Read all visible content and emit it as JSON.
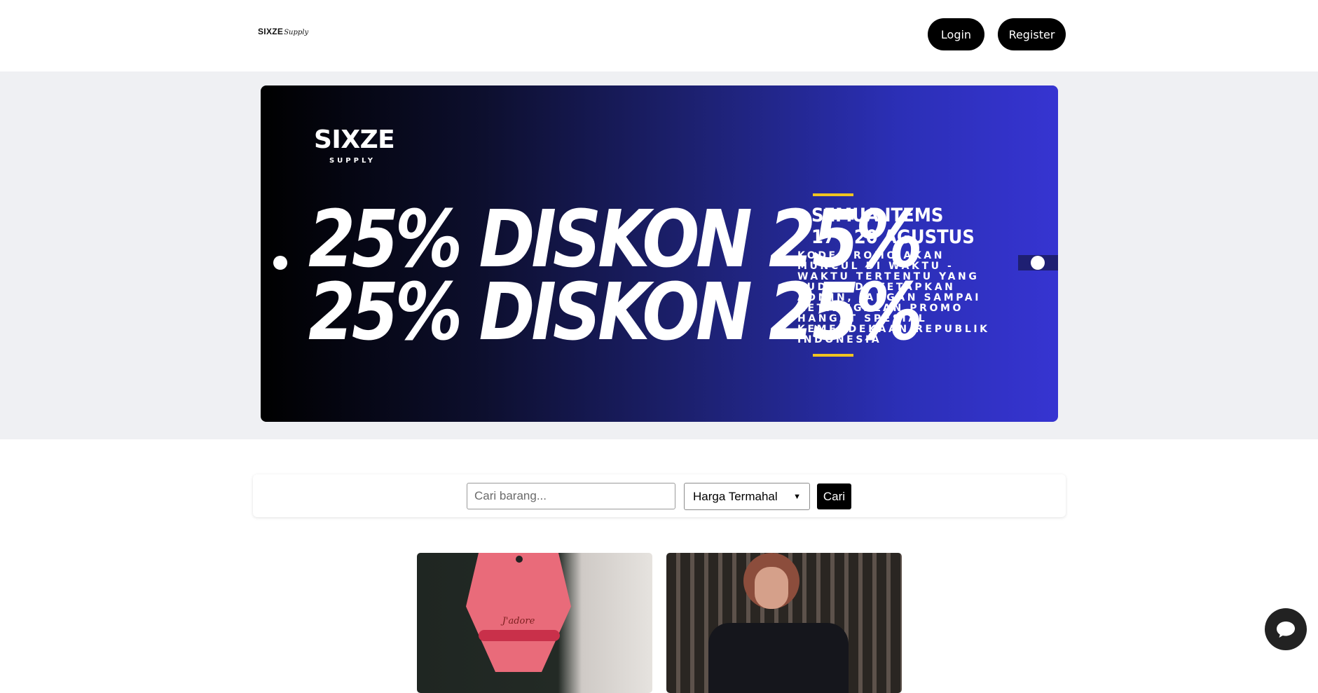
{
  "header": {
    "logo_main": "SIXZE",
    "logo_script": "Supply",
    "login_label": "Login",
    "register_label": "Register"
  },
  "banner": {
    "brand_main": "SIXZE",
    "brand_sub": "SUPPLY",
    "headline_line1": "25% DISKON 25%",
    "headline_line2": "25% DISKON 25%",
    "title_line1": "SEMUA ITEMS",
    "title_line2": "17 - 20 AGUSTUS",
    "body_text": "KODE PROMO AKAN MUNCUL DI WAKTU - WAKTU TERTENTU YANG SUDAH DI TETAPKAN ADMIN, JANGAN SAMPAI KETINGGALAN PROMO HANGAT SPESIAL KEMERDEKAAN REPUBLIK INDONESIA",
    "accent_color": "#f0c420"
  },
  "search": {
    "placeholder": "Cari barang...",
    "value": "",
    "sort_selected": "Harga Termahal",
    "button_label": "Cari"
  },
  "products": [
    {
      "tag_text": "J'adore"
    },
    {}
  ],
  "icons": {
    "chat": "chat-bubble-icon",
    "select": "chevron-down-icon"
  }
}
